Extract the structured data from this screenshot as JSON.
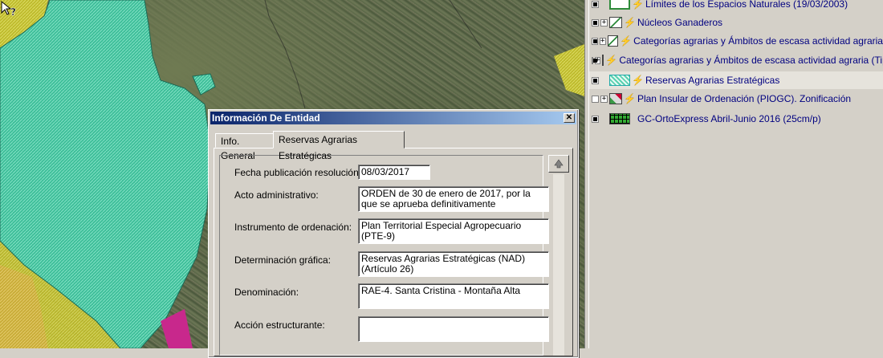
{
  "layers": [
    {
      "label": "Límites de los Espacios Naturales (19/03/2003)",
      "icon": "outline",
      "checked": true,
      "expandable": false,
      "bolt": true
    },
    {
      "label": "Núcleos Ganaderos",
      "icon": "poly",
      "checked": true,
      "expandable": true,
      "bolt": true
    },
    {
      "label": "Categorías agrarias y Ámbitos de escasa actividad agraria",
      "icon": "poly",
      "checked": true,
      "expandable": true,
      "bolt": true
    },
    {
      "label": "Categorías agrarias y Ámbitos de escasa actividad agraria (Tipos)",
      "icon": "poly",
      "checked": true,
      "expandable": true,
      "bolt": true
    },
    {
      "label": "Reservas Agrarias Estratégicas",
      "icon": "hatch",
      "checked": true,
      "expandable": false,
      "bolt": true
    },
    {
      "label": "Plan Insular de Ordenación (PIOGC). Zonificación",
      "icon": "poly2",
      "checked": false,
      "expandable": true,
      "bolt": true
    },
    {
      "label": "GC-OrtoExpress Abril-Junio 2016 (25cm/p)",
      "icon": "grid",
      "checked": true,
      "expandable": false,
      "bolt": false
    }
  ],
  "dialog": {
    "title": "Información De Entidad",
    "close_glyph": "✕",
    "tabs": [
      "Info. General",
      "Reservas Agrarias Estratégicas"
    ],
    "fields": [
      {
        "label": "Fecha publicación resolución:",
        "value": "08/03/2017"
      },
      {
        "label": "Acto administrativo:",
        "value": "ORDEN de 30 de enero de 2017, por la que se aprueba definitivamente"
      },
      {
        "label": "Instrumento de ordenación:",
        "value": "Plan Territorial Especial Agropecuario (PTE-9)"
      },
      {
        "label": "Determinación gráfica:",
        "value": "Reservas Agrarias Estratégicas (NAD) (Artículo 26)"
      },
      {
        "label": "Denominación:",
        "value": "RAE-4. Santa Cristina - Montaña Alta"
      },
      {
        "label": "Acción estructurante:",
        "value": ""
      }
    ]
  },
  "colors": {
    "reserve_fill": "#3fbf9a",
    "yellow_zone": "#d6d12a",
    "magenta_zone": "#c8288c",
    "titlebar": "#0a246a"
  },
  "icons": {
    "cursor": "help-cursor-icon",
    "scroll_up": "arrow-up-icon"
  }
}
